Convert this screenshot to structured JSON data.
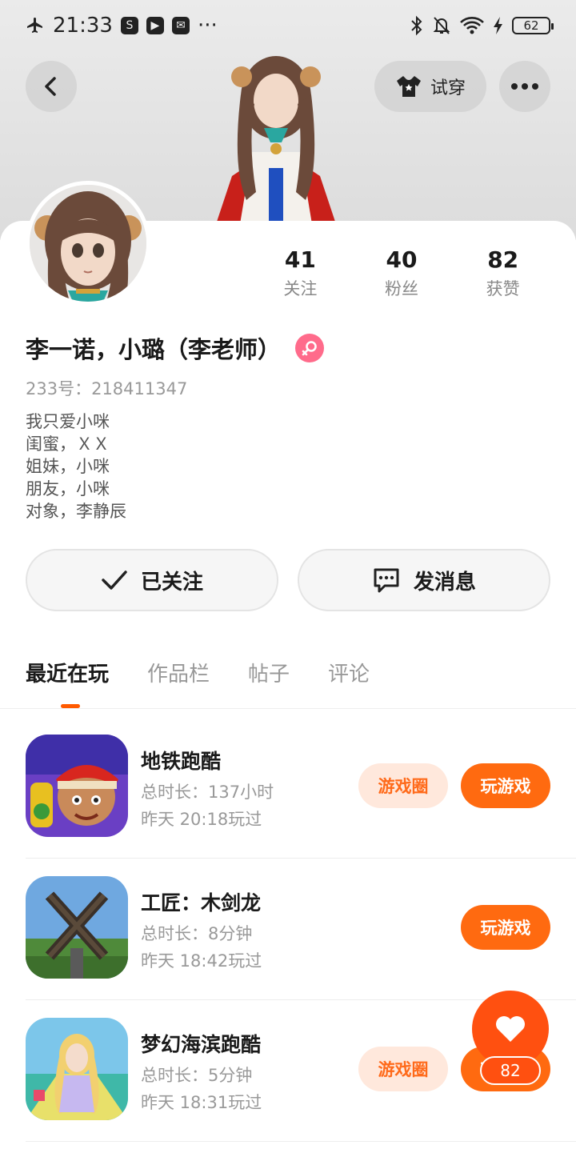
{
  "status_bar": {
    "time": "21:33",
    "battery": "62",
    "more": "···"
  },
  "top_bar": {
    "tryon_label": "试穿"
  },
  "profile": {
    "stats": [
      {
        "num": "41",
        "label": "关注"
      },
      {
        "num": "40",
        "label": "粉丝"
      },
      {
        "num": "82",
        "label": "获赞"
      }
    ],
    "name": "李一诺，小璐（李老师）",
    "uid": "233号：218411347",
    "bio": [
      "我只爱小咪",
      "闺蜜，ＸＸ",
      "姐妹，小咪",
      "朋友，小咪",
      "对象，李静辰"
    ]
  },
  "actions": {
    "follow_label": "已关注",
    "message_label": "发消息"
  },
  "tabs": [
    {
      "label": "最近在玩",
      "active": true
    },
    {
      "label": "作品栏",
      "active": false
    },
    {
      "label": "帖子",
      "active": false
    },
    {
      "label": "评论",
      "active": false
    }
  ],
  "games": [
    {
      "title": "地铁跑酷",
      "duration": "总时长：137小时",
      "last_played": "昨天 20:18玩过",
      "circle_label": "游戏圈",
      "play_label": "玩游戏"
    },
    {
      "title": "工匠：木剑龙",
      "duration": "总时长：8分钟",
      "last_played": "昨天 18:42玩过",
      "play_label": "玩游戏"
    },
    {
      "title": "梦幻海滨跑酷",
      "duration": "总时长：5分钟",
      "last_played": "昨天 18:31玩过",
      "circle_label": "游戏圈",
      "play_label": "玩游戏"
    }
  ],
  "like_fab": {
    "count": "82"
  },
  "colors": {
    "accent": "#ff6a10",
    "accent_light": "#ffe8dc",
    "female": "#ff6b8b"
  },
  "icons": [
    "airplane-icon",
    "bluetooth-icon",
    "mute-icon",
    "wifi-icon",
    "back-icon",
    "shirt-icon",
    "more-icon",
    "check-icon",
    "chat-icon",
    "heart-icon",
    "female-icon"
  ]
}
